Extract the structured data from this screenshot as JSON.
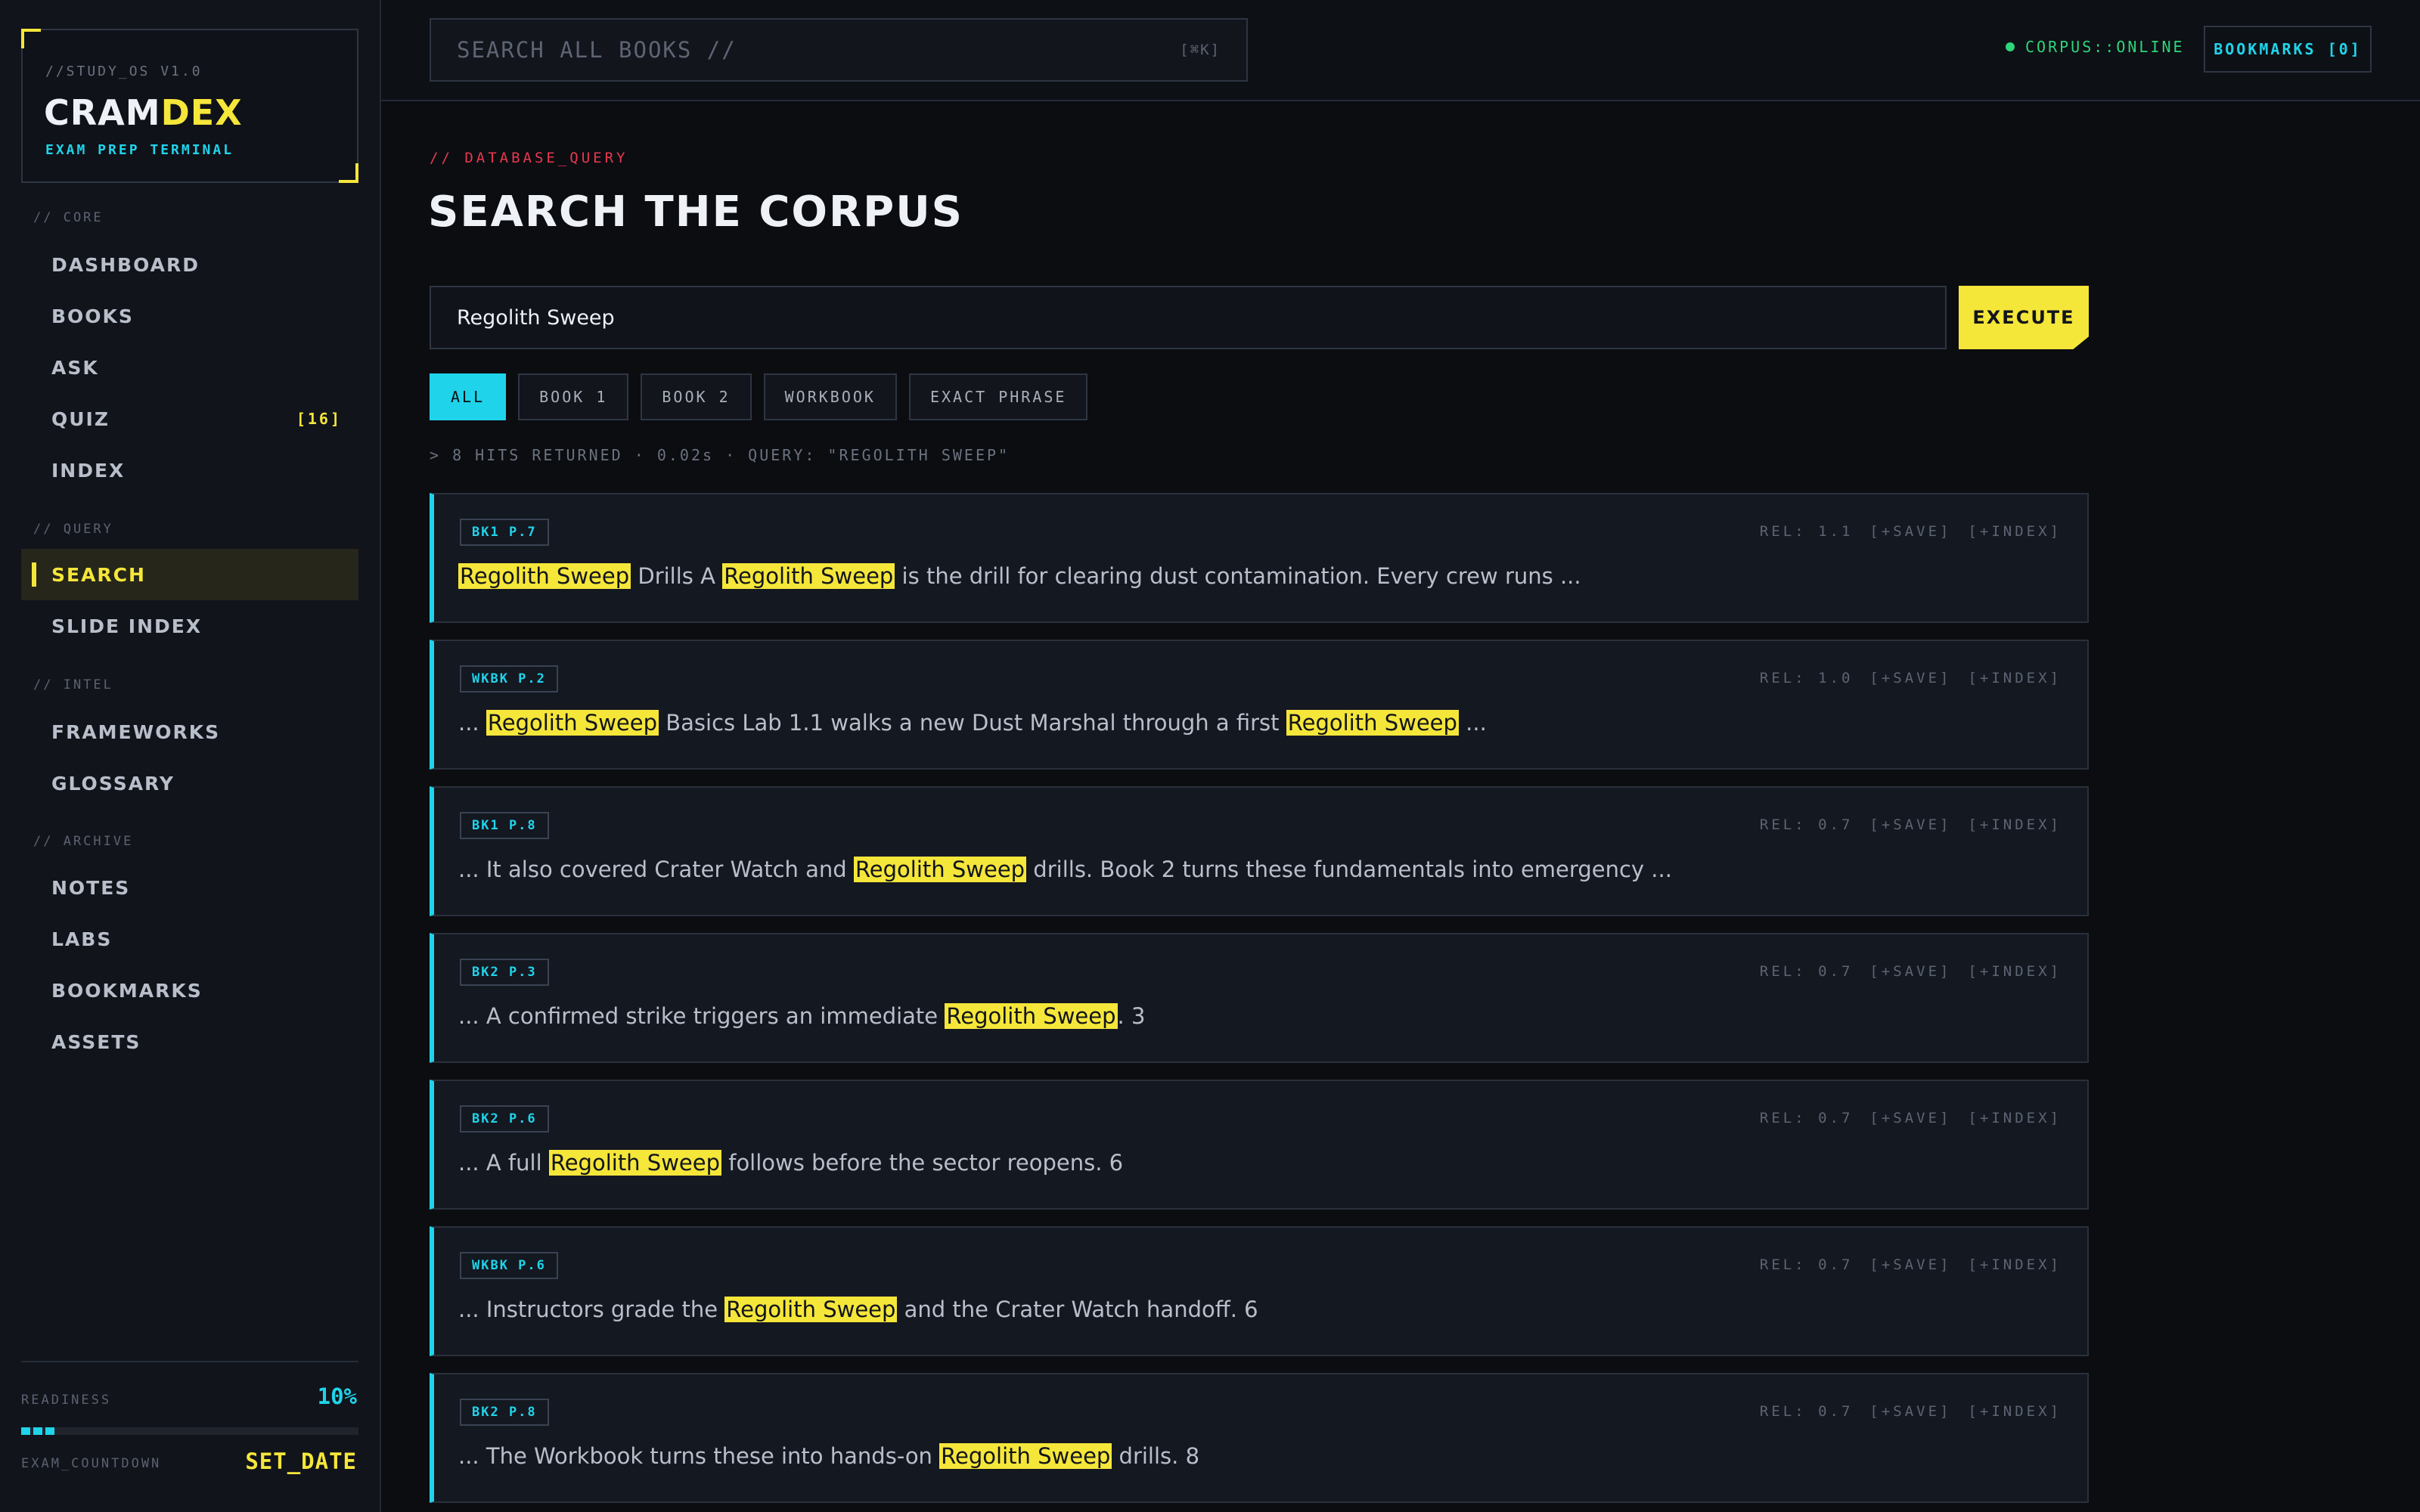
{
  "sidebar": {
    "version": "//STUDY_OS V1.0",
    "logo_a": "CRAM",
    "logo_b": "DEX",
    "subtitle": "EXAM PREP TERMINAL",
    "groups": [
      {
        "label": "// CORE",
        "items": [
          {
            "label": "DASHBOARD"
          },
          {
            "label": "BOOKS"
          },
          {
            "label": "ASK"
          },
          {
            "label": "QUIZ",
            "badge": "[16]"
          },
          {
            "label": "INDEX"
          }
        ]
      },
      {
        "label": "// QUERY",
        "items": [
          {
            "label": "SEARCH",
            "active": true
          },
          {
            "label": "SLIDE INDEX"
          }
        ]
      },
      {
        "label": "// INTEL",
        "items": [
          {
            "label": "FRAMEWORKS"
          },
          {
            "label": "GLOSSARY"
          }
        ]
      },
      {
        "label": "// ARCHIVE",
        "items": [
          {
            "label": "NOTES"
          },
          {
            "label": "LABS"
          },
          {
            "label": "BOOKMARKS"
          },
          {
            "label": "ASSETS"
          }
        ]
      }
    ],
    "readiness_label": "READINESS",
    "readiness_value": "10%",
    "readiness_fraction": 0.1,
    "countdown_label": "EXAM_COUNTDOWN",
    "countdown_value": "SET_DATE"
  },
  "topbar": {
    "search_placeholder": "SEARCH ALL BOOKS //",
    "shortcut": "[⌘K]",
    "status": "CORPUS::ONLINE",
    "bookmarks": "BOOKMARKS [0]"
  },
  "main": {
    "crumb": "// DATABASE_QUERY",
    "title": "SEARCH THE CORPUS",
    "query": "Regolith Sweep",
    "execute": "EXECUTE",
    "filters": [
      {
        "label": "ALL",
        "active": true
      },
      {
        "label": "BOOK 1"
      },
      {
        "label": "BOOK 2"
      },
      {
        "label": "WORKBOOK"
      },
      {
        "label": "EXACT PHRASE"
      }
    ],
    "hits": "> 8 HITS RETURNED · 0.02s · QUERY: \"REGOLITH SWEEP\"",
    "save_label": "[+SAVE]",
    "index_label": "[+INDEX]",
    "results": [
      {
        "tag": "BK1 P.7",
        "rel": "REL: 1.1",
        "parts": [
          {
            "t": "Regolith Sweep",
            "h": true
          },
          {
            "t": " Drills A "
          },
          {
            "t": "Regolith Sweep",
            "h": true
          },
          {
            "t": " is the drill for clearing dust contamination. Every crew runs ..."
          }
        ]
      },
      {
        "tag": "WKBK P.2",
        "rel": "REL: 1.0",
        "parts": [
          {
            "t": "... "
          },
          {
            "t": "Regolith Sweep",
            "h": true
          },
          {
            "t": " Basics Lab 1.1 walks a new Dust Marshal through a first "
          },
          {
            "t": "Regolith Sweep",
            "h": true
          },
          {
            "t": " ..."
          }
        ]
      },
      {
        "tag": "BK1 P.8",
        "rel": "REL: 0.7",
        "parts": [
          {
            "t": "... It also covered Crater Watch and "
          },
          {
            "t": "Regolith Sweep",
            "h": true
          },
          {
            "t": " drills. Book 2 turns these fundamentals into emergency ..."
          }
        ]
      },
      {
        "tag": "BK2 P.3",
        "rel": "REL: 0.7",
        "parts": [
          {
            "t": "... A confirmed strike triggers an immediate "
          },
          {
            "t": "Regolith Sweep",
            "h": true
          },
          {
            "t": ". 3"
          }
        ]
      },
      {
        "tag": "BK2 P.6",
        "rel": "REL: 0.7",
        "parts": [
          {
            "t": "... A full "
          },
          {
            "t": "Regolith Sweep",
            "h": true
          },
          {
            "t": " follows before the sector reopens. 6"
          }
        ]
      },
      {
        "tag": "WKBK P.6",
        "rel": "REL: 0.7",
        "parts": [
          {
            "t": "... Instructors grade the "
          },
          {
            "t": "Regolith Sweep",
            "h": true
          },
          {
            "t": " and the Crater Watch handoff. 6"
          }
        ]
      },
      {
        "tag": "BK2 P.8",
        "rel": "REL: 0.7",
        "parts": [
          {
            "t": "... The Workbook turns these into hands-on "
          },
          {
            "t": "Regolith Sweep",
            "h": true
          },
          {
            "t": " drills. 8"
          }
        ]
      }
    ]
  },
  "colors": {
    "accent_yellow": "#f5e63a",
    "accent_cyan": "#1fd4ea",
    "crumb_red": "#e8384f",
    "status_green": "#2fd57a",
    "background": "#0b0d11"
  }
}
